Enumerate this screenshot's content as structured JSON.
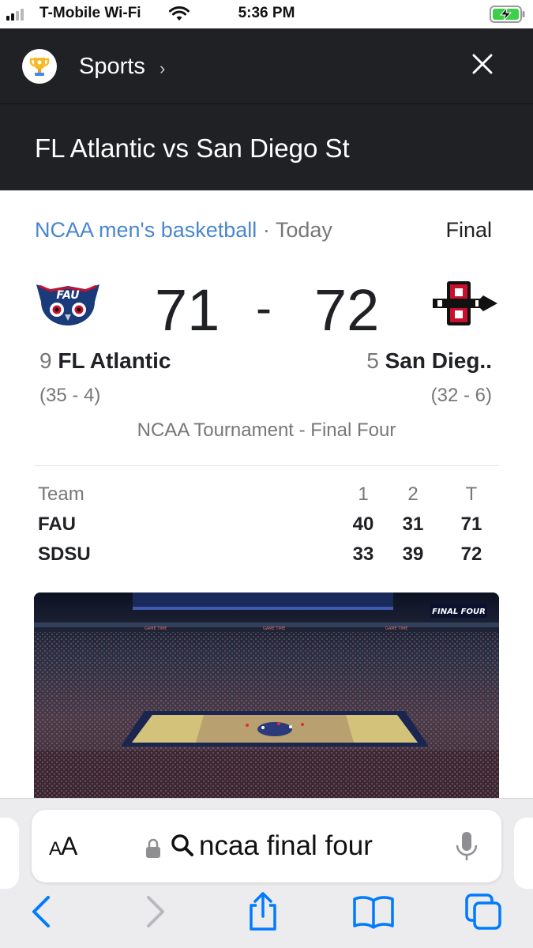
{
  "status_bar": {
    "carrier": "T-Mobile Wi-Fi",
    "time": "5:36 PM",
    "battery_state": "charging",
    "signal_bars": 2
  },
  "header": {
    "section_label": "Sports",
    "matchup_title": "FL Atlantic vs San Diego St",
    "logo_icon": "trophy-icon",
    "close_icon": "close-icon"
  },
  "game": {
    "league": "NCAA men's basketball",
    "separator": "·",
    "date": "Today",
    "status": "Final",
    "home": {
      "seed": "9",
      "name": "FL Atlantic",
      "record": "(35 - 4)",
      "score": "71",
      "logo_icon": "fau-owl-logo"
    },
    "away": {
      "seed": "5",
      "name": "San Dieg..",
      "record": "(32 - 6)",
      "score": "72",
      "logo_icon": "sdsu-logo"
    },
    "score_separator": "-",
    "tournament": "NCAA Tournament - Final Four"
  },
  "linescore": {
    "headers": [
      "Team",
      "1",
      "2",
      "T"
    ],
    "rows": [
      [
        "FAU",
        "40",
        "31",
        "71"
      ],
      [
        "SDSU",
        "33",
        "39",
        "72"
      ]
    ]
  },
  "video": {
    "description_icon": "video-thumbnail"
  },
  "browser": {
    "text_size_label_small": "A",
    "text_size_label_large": "A",
    "query": "ncaa final four",
    "colors": {
      "accent": "#007aff",
      "disabled": "#b9b9bd"
    }
  },
  "colors": {
    "header_bg": "#202124",
    "link": "#4a86cf",
    "fau_blue": "#1b3a7a",
    "fau_red": "#c8102e",
    "sdsu_red": "#c8102e",
    "battery_green": "#3ecf4a"
  }
}
